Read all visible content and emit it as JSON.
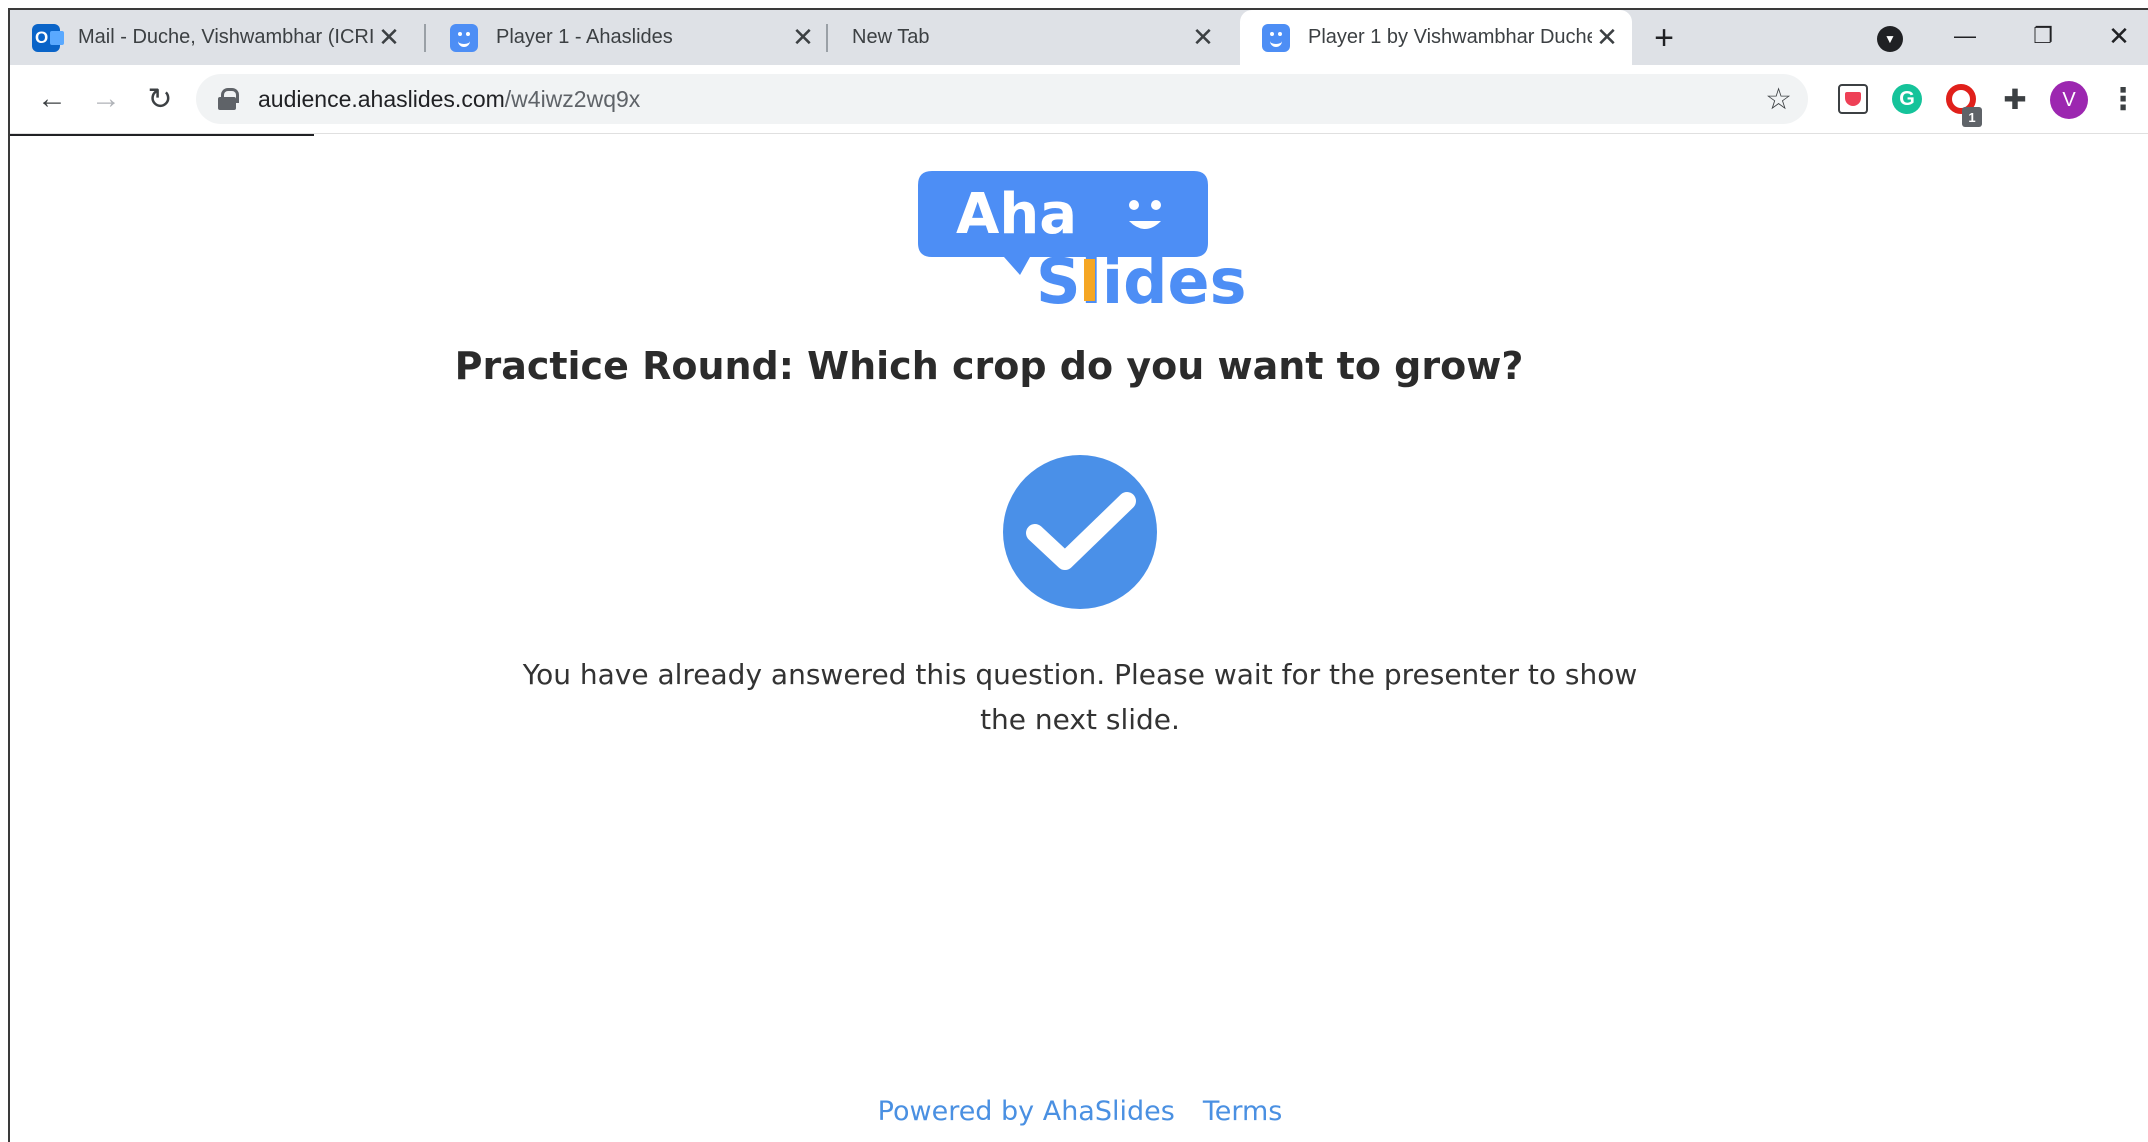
{
  "tabs": [
    {
      "title": "Mail - Duche, Vishwambhar (ICRI",
      "favicon": "outlook-icon"
    },
    {
      "title": "Player 1 - Ahaslides",
      "favicon": "ahaslides-icon"
    },
    {
      "title": "New Tab",
      "favicon": ""
    },
    {
      "title": "Player 1 by Vishwambhar Duche",
      "favicon": "ahaslides-icon",
      "active": true
    }
  ],
  "toolbar": {
    "url_host": "audience.ahaslides.com",
    "url_path": "/w4iwz2wq9x",
    "extension_badge": "1",
    "avatar_letter": "V"
  },
  "logo": {
    "line1": "Aha",
    "line2": "Slides",
    "colors": {
      "blue": "#4d8ef5",
      "accent": "#f5a623"
    }
  },
  "page": {
    "question": "Practice Round: Which crop do you want to grow?",
    "message": "You have already answered this question. Please wait for the presenter to show the next slide.",
    "check_color": "#4a90e8"
  },
  "footer": {
    "powered_by": "Powered by AhaSlides",
    "terms": "Terms"
  }
}
